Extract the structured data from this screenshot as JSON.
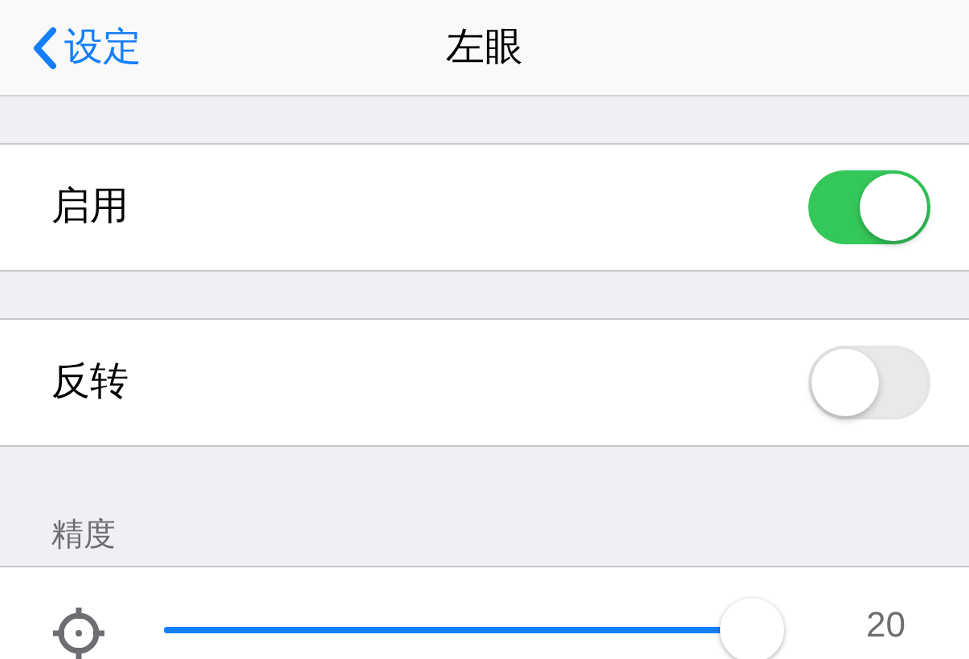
{
  "nav": {
    "back": "设定",
    "title": "左眼"
  },
  "rows": [
    {
      "kind": "toggle",
      "label": "启用",
      "on": true
    },
    {
      "kind": "toggle",
      "label": "反转",
      "on": false
    }
  ],
  "section": {
    "header": "精度",
    "slider": {
      "level": 0.95,
      "reading": "20"
    }
  }
}
